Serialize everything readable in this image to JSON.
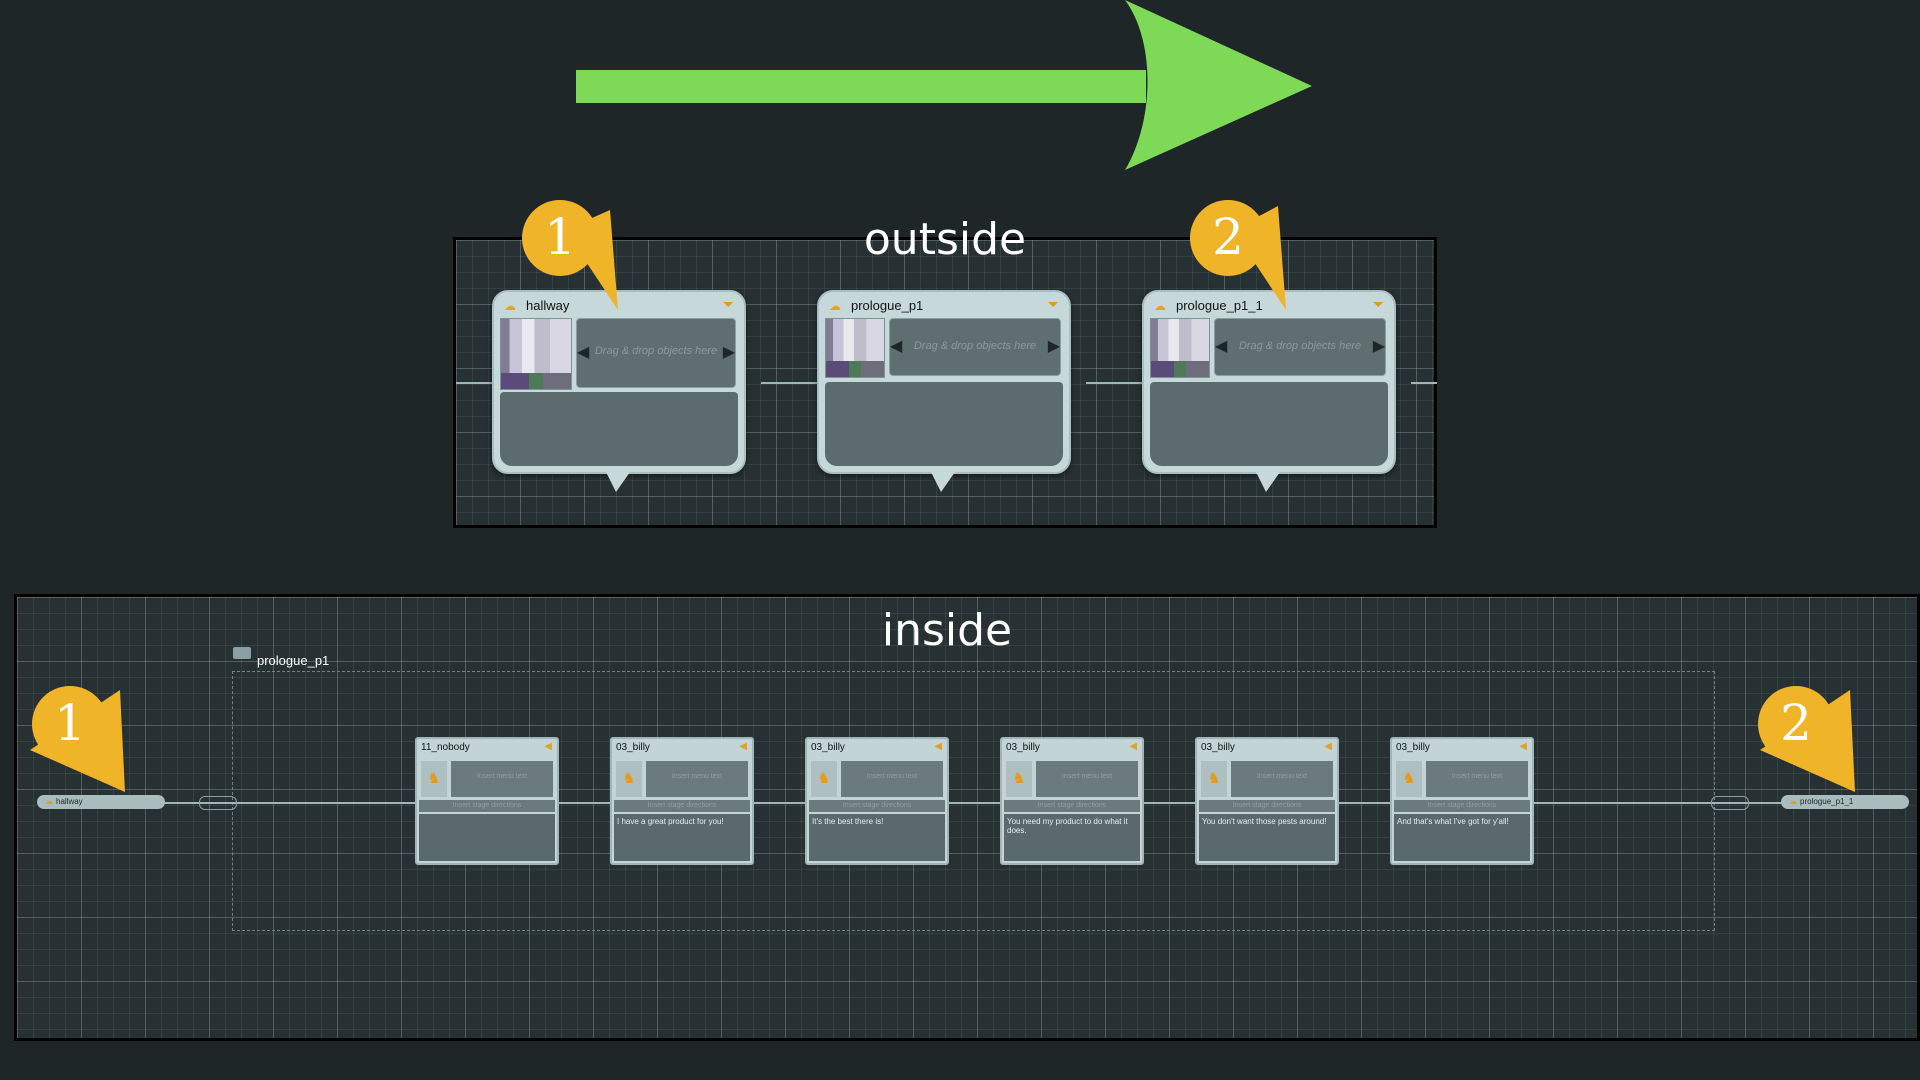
{
  "colors": {
    "arrow": "#7ed957",
    "badge": "#f0b429",
    "background": "#1e2628"
  },
  "outside": {
    "title": "outside",
    "drop_hint": "Drag & drop objects here",
    "nodes": [
      {
        "title": "hallway"
      },
      {
        "title": "prologue_p1"
      },
      {
        "title": "prologue_p1_1"
      }
    ]
  },
  "inside": {
    "title": "inside",
    "group_label": "prologue_p1",
    "start_pill": "hallway",
    "end_pill": "prologue_p1_1",
    "menu_text": "Insert menu text",
    "stage_text": "Insert stage directions",
    "nodes": [
      {
        "speaker": "11_nobody",
        "text": ""
      },
      {
        "speaker": "03_billy",
        "text": "I have a great product for you!"
      },
      {
        "speaker": "03_billy",
        "text": "It's the best there is!"
      },
      {
        "speaker": "03_billy",
        "text": "You need my product to do what it does."
      },
      {
        "speaker": "03_billy",
        "text": "You don't want those pests around!"
      },
      {
        "speaker": "03_billy",
        "text": "And that's what I've got for y'all!"
      }
    ]
  },
  "badges": {
    "one": "1",
    "two": "2"
  }
}
